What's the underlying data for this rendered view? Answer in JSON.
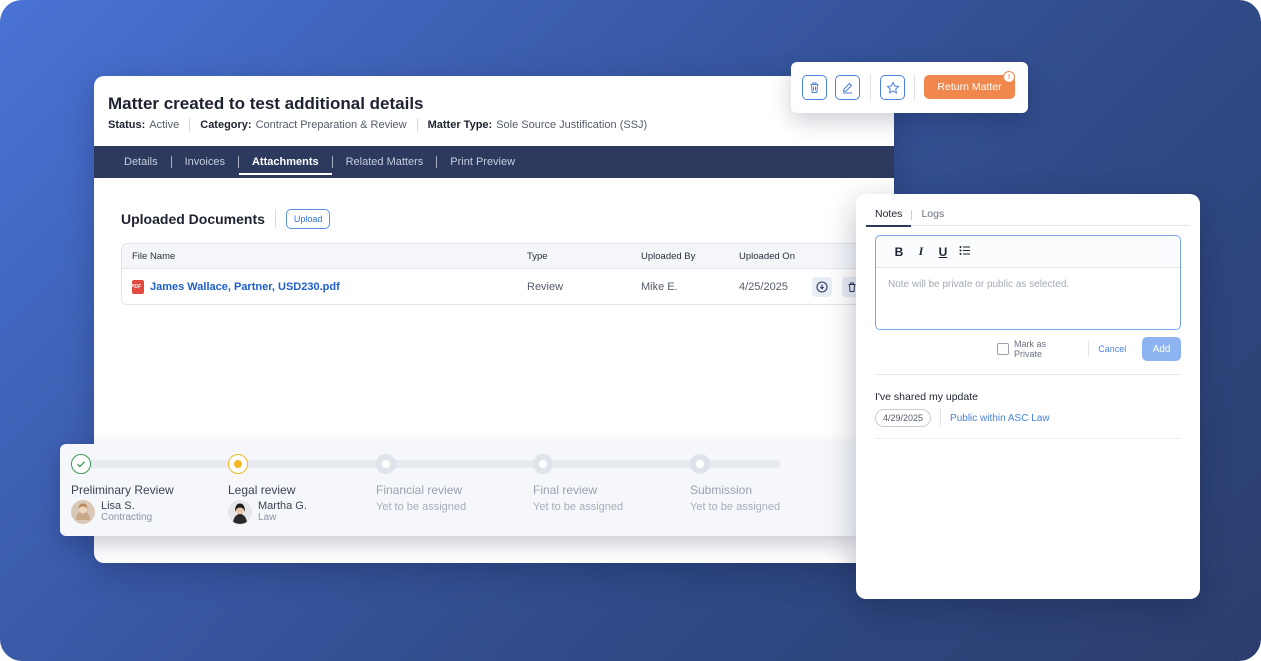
{
  "matter": {
    "title": "Matter created to test additional details",
    "status_key": "Status:",
    "status_val": "Active",
    "category_key": "Category:",
    "category_val": "Contract Preparation & Review",
    "type_key": "Matter Type:",
    "type_val": "Sole Source Justification (SSJ)"
  },
  "tabs": [
    "Details",
    "Invoices",
    "Attachments",
    "Related Matters",
    "Print Preview"
  ],
  "active_tab": "Attachments",
  "documents": {
    "title": "Uploaded Documents",
    "upload_label": "Upload",
    "columns": [
      "File Name",
      "Type",
      "Uploaded By",
      "Uploaded On"
    ],
    "rows": [
      {
        "file_name": "James Wallace, Partner, USD230.pdf",
        "type": "Review",
        "uploaded_by": "Mike E.",
        "uploaded_on": "4/25/2025"
      }
    ]
  },
  "toolbar": {
    "return_label": "Return Matter",
    "icons": [
      "trash-icon",
      "edit-icon",
      "star-icon"
    ],
    "accent": "#f0884e"
  },
  "stepper": {
    "steps": [
      {
        "label": "Preliminary Review",
        "state": "done",
        "assignee": "Lisa S.",
        "role": "Contracting"
      },
      {
        "label": "Legal review",
        "state": "current",
        "assignee": "Martha G.",
        "role": "Law"
      },
      {
        "label": "Financial review",
        "state": "pending",
        "note": "Yet to be assigned"
      },
      {
        "label": "Final review",
        "state": "pending",
        "note": "Yet to be assigned"
      },
      {
        "label": "Submission",
        "state": "pending",
        "note": "Yet to be assigned"
      }
    ],
    "colors": {
      "done": "#3a9a52",
      "current": "#f2b81c",
      "pending": "#dfe3ea"
    }
  },
  "notes": {
    "tabs": [
      "Notes",
      "Logs"
    ],
    "active_tab": "Notes",
    "editor_tools": [
      "B",
      "I",
      "U"
    ],
    "placeholder": "Note will be private or public as selected.",
    "mark_private_label": "Mark as Private",
    "cancel_label": "Cancel",
    "add_label": "Add",
    "entries": [
      {
        "text": "I've shared my update",
        "date": "4/29/2025",
        "visibility": "Public within ASC Law"
      }
    ]
  }
}
